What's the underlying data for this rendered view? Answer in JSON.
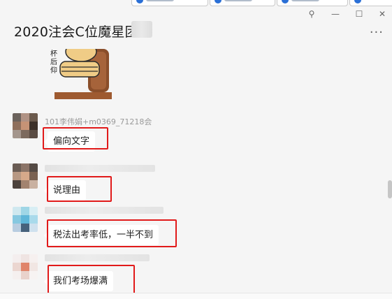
{
  "window": {
    "title": "2020注会C位魔星团",
    "controls": {
      "pin": "⚲",
      "minimize": "—",
      "maximize": "☐",
      "close": "✕"
    },
    "more": "···"
  },
  "messages": [
    {
      "sender": "101李伟娟+m0369_71218会",
      "text": "偏向文字"
    },
    {
      "sender": "",
      "text": "说理由"
    },
    {
      "sender": "",
      "text": "税法出考率低，一半不到"
    },
    {
      "sender": "",
      "text": "我们考场爆满"
    }
  ],
  "sticker": {
    "caption": "杯后仰"
  }
}
